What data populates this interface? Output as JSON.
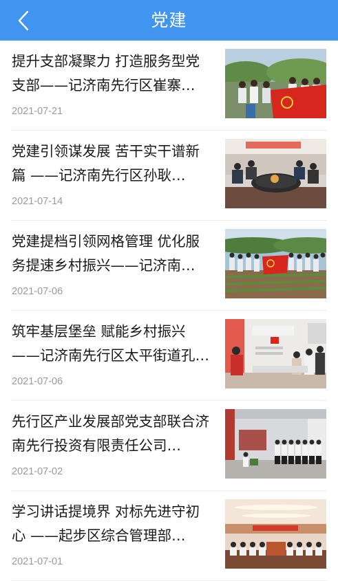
{
  "header": {
    "title": "党建"
  },
  "articles": [
    {
      "title": "提升支部凝聚力 打造服务型党支部——记济南先行区崔寨…",
      "date": "2021-07-21",
      "image": "party-members-outdoor-flag"
    },
    {
      "title": "党建引领谋发展 苦干实干谱新篇 ——记济南先行区孙耿…",
      "date": "2021-07-14",
      "image": "meeting-room-table"
    },
    {
      "title": "党建提档引领网格管理 优化服务提速乡村振兴——记济南…",
      "date": "2021-07-06",
      "image": "field-group-flag"
    },
    {
      "title": "筑牢基层堡垒 赋能乡村振兴——记济南先行区太平街道孔…",
      "date": "2021-07-06",
      "image": "party-room-gathering"
    },
    {
      "title": "先行区产业发展部党支部联合济南先行投资有限责任公司…",
      "date": "2021-07-02",
      "image": "group-oath-hall"
    },
    {
      "title": "学习讲话提境界 对标先进守初心 ——起步区综合管理部…",
      "date": "2021-07-01",
      "image": "conference-hall"
    }
  ],
  "colors": {
    "header": "#3f95ef",
    "title_text": "#1a1a1a",
    "date_text": "#9a9a9a"
  }
}
